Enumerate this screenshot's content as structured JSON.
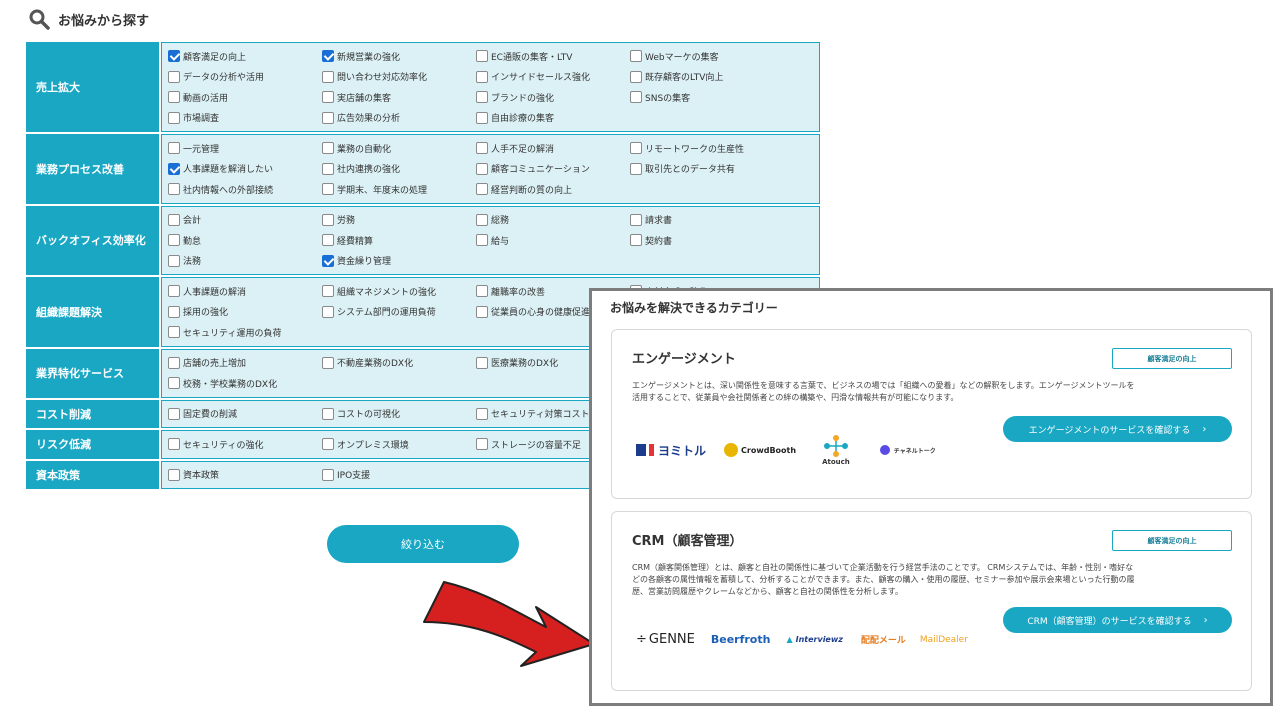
{
  "header": {
    "title": "お悩みから探す",
    "icon": "search-icon"
  },
  "categories": [
    {
      "label": "売上拡大",
      "items": [
        {
          "text": "顧客満足の向上",
          "checked": true
        },
        {
          "text": "新規営業の強化",
          "checked": true
        },
        {
          "text": "EC通販の集客・LTV",
          "checked": false
        },
        {
          "text": "Webマーケの集客",
          "checked": false
        },
        {
          "text": "データの分析や活用",
          "checked": false
        },
        {
          "text": "問い合わせ対応効率化",
          "checked": false
        },
        {
          "text": "インサイドセールス強化",
          "checked": false
        },
        {
          "text": "既存顧客のLTV向上",
          "checked": false
        },
        {
          "text": "動画の活用",
          "checked": false
        },
        {
          "text": "実店舗の集客",
          "checked": false
        },
        {
          "text": "ブランドの強化",
          "checked": false
        },
        {
          "text": "SNSの集客",
          "checked": false
        },
        {
          "text": "市場調査",
          "checked": false
        },
        {
          "text": "広告効果の分析",
          "checked": false
        },
        {
          "text": "自由診療の集客",
          "checked": false
        }
      ]
    },
    {
      "label": "業務プロセス改善",
      "items": [
        {
          "text": "一元管理",
          "checked": false
        },
        {
          "text": "業務の自動化",
          "checked": false
        },
        {
          "text": "人手不足の解消",
          "checked": false
        },
        {
          "text": "リモートワークの生産性",
          "checked": false
        },
        {
          "text": "人事課題を解消したい",
          "checked": true
        },
        {
          "text": "社内連携の強化",
          "checked": false
        },
        {
          "text": "顧客コミュニケーション",
          "checked": false
        },
        {
          "text": "取引先とのデータ共有",
          "checked": false
        },
        {
          "text": "社内情報への外部接続",
          "checked": false
        },
        {
          "text": "学期末、年度末の処理",
          "checked": false
        },
        {
          "text": "経営判断の質の向上",
          "checked": false
        }
      ]
    },
    {
      "label": "バックオフィス効率化",
      "items": [
        {
          "text": "会計",
          "checked": false
        },
        {
          "text": "労務",
          "checked": false
        },
        {
          "text": "総務",
          "checked": false
        },
        {
          "text": "請求書",
          "checked": false
        },
        {
          "text": "勤怠",
          "checked": false
        },
        {
          "text": "経費精算",
          "checked": false
        },
        {
          "text": "給与",
          "checked": false
        },
        {
          "text": "契約書",
          "checked": false
        },
        {
          "text": "法務",
          "checked": false
        },
        {
          "text": "資金繰り管理",
          "checked": true
        }
      ]
    },
    {
      "label": "組織課題解決",
      "items": [
        {
          "text": "人事課題の解消",
          "checked": false
        },
        {
          "text": "組織マネジメントの強化",
          "checked": false
        },
        {
          "text": "離職率の改善",
          "checked": false
        },
        {
          "text": "人材育成の強化",
          "checked": false
        },
        {
          "text": "採用の強化",
          "checked": false
        },
        {
          "text": "システム部門の運用負荷",
          "checked": false
        },
        {
          "text": "従業員の心身の健康促進",
          "checked": false
        },
        {
          "text": "",
          "checked": false
        },
        {
          "text": "セキュリティ運用の負荷",
          "checked": false
        }
      ]
    },
    {
      "label": "業界特化サービス",
      "items": [
        {
          "text": "店舗の売上増加",
          "checked": false
        },
        {
          "text": "不動産業務のDX化",
          "checked": false
        },
        {
          "text": "医療業務のDX化",
          "checked": false
        },
        {
          "text": "",
          "checked": false
        },
        {
          "text": "校務・学校業務のDX化",
          "checked": false
        }
      ]
    },
    {
      "label": "コスト削減",
      "items": [
        {
          "text": "固定費の削減",
          "checked": false
        },
        {
          "text": "コストの可視化",
          "checked": false
        },
        {
          "text": "セキュリティ対策コスト",
          "checked": false
        }
      ]
    },
    {
      "label": "リスク低減",
      "items": [
        {
          "text": "セキュリティの強化",
          "checked": false
        },
        {
          "text": "オンプレミス環境",
          "checked": false
        },
        {
          "text": "ストレージの容量不足",
          "checked": false
        }
      ]
    },
    {
      "label": "資本政策",
      "items": [
        {
          "text": "資本政策",
          "checked": false
        },
        {
          "text": "IPO支援",
          "checked": false
        }
      ]
    }
  ],
  "filter_button": "絞り込む",
  "result_panel": {
    "title": "お悩みを解決できるカテゴリー",
    "cards": [
      {
        "name": "エンゲージメント",
        "tag": "顧客満足の向上",
        "desc_lines": [
          "エンゲージメントとは、深い関係性を意味する言葉で、ビジネスの場では「組織への愛着」などの解釈をします。エンゲージメントツールを",
          "活用することで、従業員や会社関係者との絆の構築や、円滑な情報共有が可能になります。"
        ],
        "cta": "エンゲージメントのサービスを確認する",
        "logos": [
          "ヨミトル",
          "CrowdBooth",
          "Atouch",
          "チャネルトーク"
        ]
      },
      {
        "name": "CRM（顧客管理）",
        "tag": "顧客満足の向上",
        "desc_lines": [
          "CRM（顧客関係管理）とは、顧客と自社の関係性に基づいて企業活動を行う経営手法のことです。 CRMシステムでは、年齢・性別・嗜好な",
          "どの各顧客の属性情報を蓄積して、分析することができます。また、顧客の購入・使用の履歴、セミナー参加や展示会来場といった行動の履",
          "歴、営業訪問履歴やクレームなどから、顧客と自社の関係性を分析します。"
        ],
        "cta": "CRM（顧客管理）のサービスを確認する",
        "logos": [
          "GENNE",
          "Beerfroth",
          "Interviewz",
          "配配メール",
          "MailDealer"
        ]
      }
    ]
  },
  "colors": {
    "accent": "#1aa7c4",
    "checkbox": "#1a6fd6",
    "arrow": "#d61f1f"
  }
}
